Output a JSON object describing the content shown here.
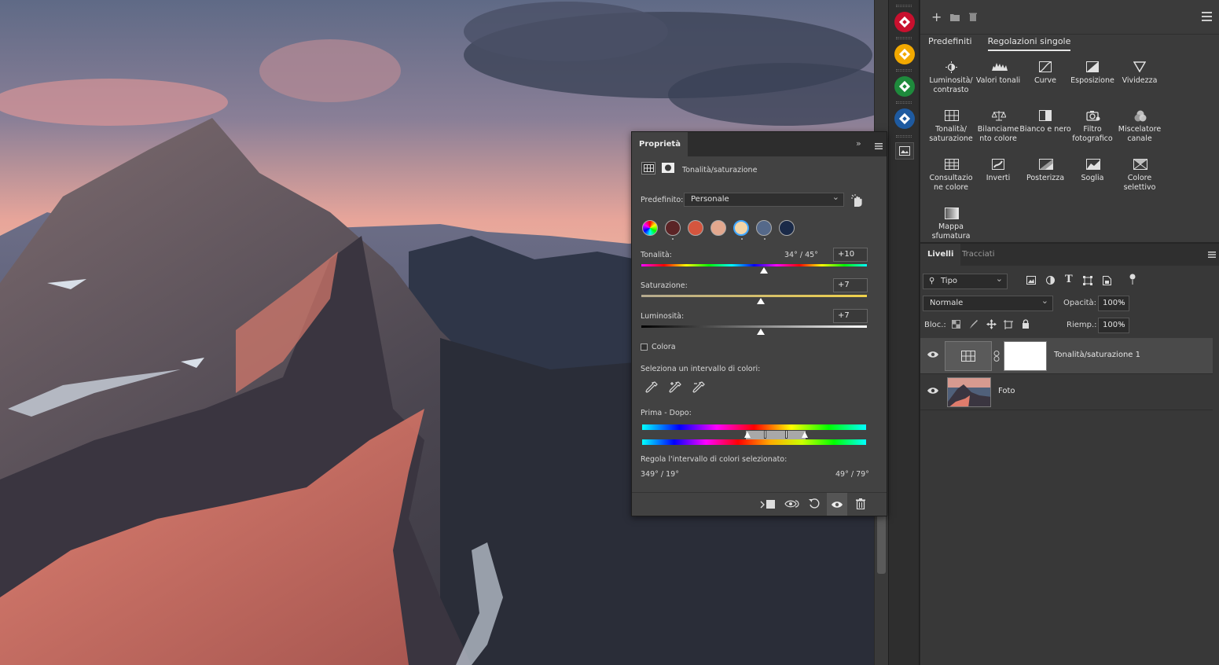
{
  "plugins": {
    "colors": [
      "#c8102e",
      "#f2a900",
      "#1e8a3c",
      "#1e5aa0"
    ]
  },
  "adjustments": {
    "tabs": [
      {
        "label": "Predefiniti",
        "active": false
      },
      {
        "label": "Regolazioni singole",
        "active": true
      }
    ],
    "items": [
      {
        "label": "Luminosità/ contrasto",
        "icon": "sun-icon"
      },
      {
        "label": "Valori tonali",
        "icon": "levels-icon"
      },
      {
        "label": "Curve",
        "icon": "curves-icon"
      },
      {
        "label": "Esposizione",
        "icon": "exposure-icon"
      },
      {
        "label": "Vividezza",
        "icon": "vibrance-icon"
      },
      {
        "label": "Tonalità/ saturazione",
        "icon": "hue-saturation-icon"
      },
      {
        "label": "Bilanciame nto colore",
        "icon": "color-balance-icon"
      },
      {
        "label": "Bianco e nero",
        "icon": "black-white-icon"
      },
      {
        "label": "Filtro fotografico",
        "icon": "photo-filter-icon"
      },
      {
        "label": "Miscelatore canale",
        "icon": "channel-mixer-icon"
      },
      {
        "label": "Consultazio ne colore",
        "icon": "color-lookup-icon"
      },
      {
        "label": "Inverti",
        "icon": "invert-icon"
      },
      {
        "label": "Posterizza",
        "icon": "posterize-icon"
      },
      {
        "label": "Soglia",
        "icon": "threshold-icon"
      },
      {
        "label": "Colore selettivo",
        "icon": "selective-color-icon"
      },
      {
        "label": "Mappa sfumatura",
        "icon": "gradient-map-icon"
      }
    ]
  },
  "layers": {
    "tabs": [
      {
        "label": "Livelli",
        "active": true
      },
      {
        "label": "Tracciati",
        "active": false
      }
    ],
    "filter": "Tipo",
    "blend_mode": "Normale",
    "opacity_label": "Opacità:",
    "opacity": "100%",
    "lock_label": "Bloc.:",
    "fill_label": "Riemp.:",
    "fill": "100%",
    "rows": [
      {
        "name": "Tonalità/saturazione 1",
        "selected": true
      },
      {
        "name": "Foto",
        "selected": false
      }
    ]
  },
  "properties": {
    "tab": "Proprietà",
    "subtitle": "Tonalità/saturazione",
    "preset_label": "Predefinito:",
    "preset_value": "Personale",
    "swatches": [
      "#5b2426",
      "#d4553e",
      "#e3a88e",
      "#f3d4a6",
      "#55698a",
      "#1a2a48"
    ],
    "hue_label": "Tonalità:",
    "hue_range": "34° / 45°",
    "hue_value": "+10",
    "hue_level": 0.545,
    "sat_label": "Saturazione:",
    "sat_value": "+7",
    "sat_level": 0.53,
    "lum_label": "Luminosità:",
    "lum_value": "+7",
    "lum_level": 0.53,
    "colorize_label": "Colora",
    "select_range_label": "Seleziona un intervallo di colori:",
    "before_after_label": "Prima - Dopo:",
    "adjust_range_label": "Regola l'intervallo di colori selezionato:",
    "range_left": "349° / 19°",
    "range_right": "49° / 79°"
  }
}
